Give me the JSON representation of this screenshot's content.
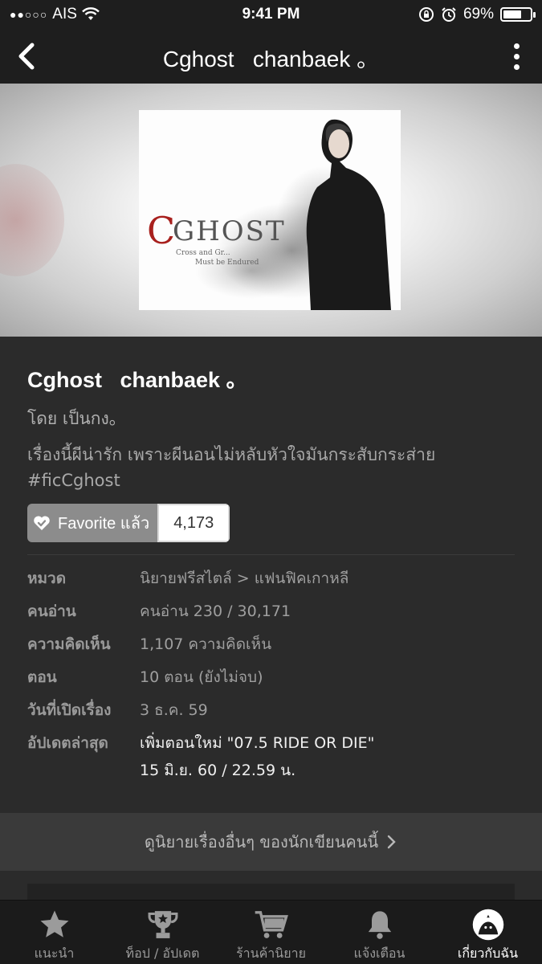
{
  "status_bar": {
    "carrier": "AIS",
    "time": "9:41 PM",
    "battery": "69%",
    "battery_level": 0.69
  },
  "nav": {
    "title": "Cghost   chanbaek 。"
  },
  "cover": {
    "logo_text": "CGHOST",
    "logo_subtitle": "Cross and Gr... Must be Endured"
  },
  "story": {
    "title": "Cghost   chanbaek 。",
    "author": "โดย เป็นกง。",
    "description": "เรื่องนี้ผีน่ารัก เพราะผีนอนไม่หลับหัวใจมันกระสับกระส่าย #ficCghost",
    "favorite_label": "Favorite แล้ว",
    "favorite_count": "4,173"
  },
  "meta": [
    {
      "key": "หมวด",
      "value": "นิยายฟรีสไตล์ > แฟนฟิคเกาหลี"
    },
    {
      "key": "คนอ่าน",
      "value": "คนอ่าน 230 / 30,171"
    },
    {
      "key": "ความคิดเห็น",
      "value": "1,107 ความคิดเห็น"
    },
    {
      "key": "ตอน",
      "value": "10 ตอน (ยังไม่จบ)"
    },
    {
      "key": "วันที่เปิดเรื่อง",
      "value": "3 ธ.ค. 59"
    },
    {
      "key": "อัปเดตล่าสุด",
      "value": "เพิ่มตอนใหม่ \"07.5  RIDE OR DIE\"",
      "value2": "15 มิ.ย. 60 / 22.59 น."
    }
  ],
  "more_by_author": "ดูนิยายเรื่องอื่นๆ ของนักเขียนคนนี้",
  "tabs": [
    {
      "label": "แนะนำ",
      "icon": "star-icon"
    },
    {
      "label": "ท็อป / อัปเดต",
      "icon": "trophy-icon"
    },
    {
      "label": "ร้านค้านิยาย",
      "icon": "cart-icon"
    },
    {
      "label": "แจ้งเตือน",
      "icon": "bell-icon"
    },
    {
      "label": "เกี่ยวกับฉัน",
      "icon": "avatar-icon",
      "active": true
    }
  ]
}
